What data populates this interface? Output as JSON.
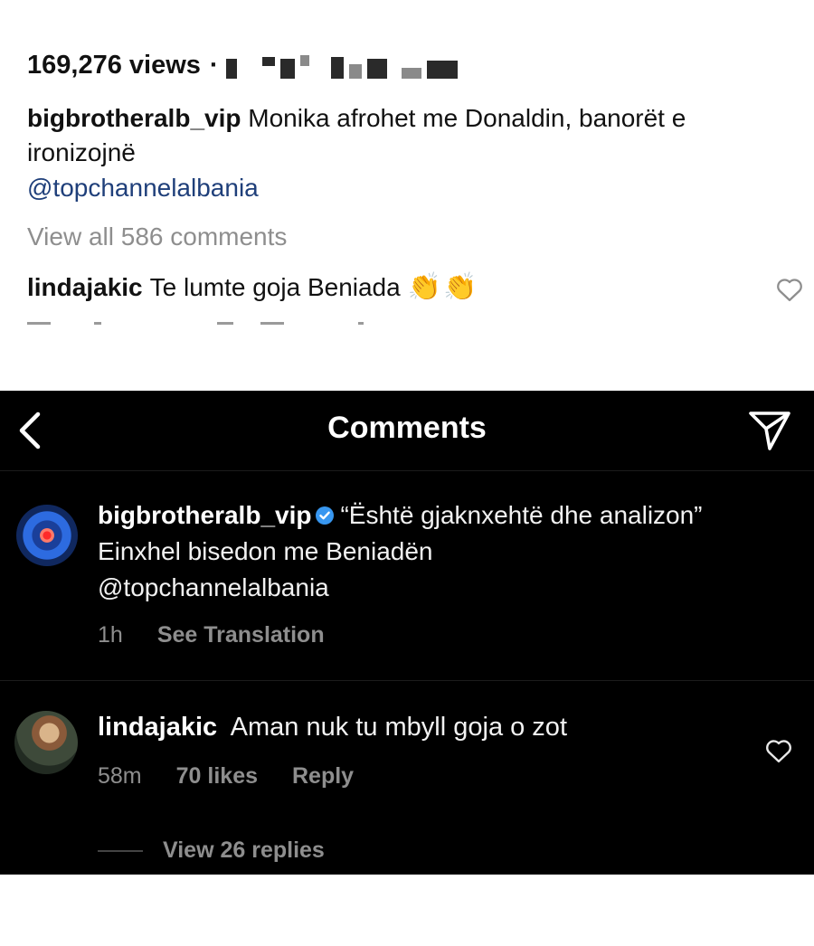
{
  "post_light": {
    "views": "169,276 views",
    "separator": "·",
    "caption_user": "bigbrotheralb_vip",
    "caption_text": "Monika afrohet me Donaldin, banorët e ironizojnë",
    "mention": "@topchannelalbania",
    "view_all": "View all 586 comments",
    "comment": {
      "user": "lindajakic",
      "text": "Te lumte goja Beniada",
      "emoji": "👏👏"
    }
  },
  "comments_screen": {
    "title": "Comments",
    "post": {
      "user": "bigbrotheralb_vip",
      "text_line1": "“Është gjaknxehtë dhe analizon”",
      "text_line2": "Einxhel bisedon me Beniadën",
      "mention": "@topchannelalbania",
      "time": "1h",
      "see_translation": "See Translation"
    },
    "comment": {
      "user": "lindajakic",
      "text": "Aman nuk tu mbyll goja o zot",
      "time": "58m",
      "likes": "70 likes",
      "reply": "Reply",
      "view_replies": "View 26 replies"
    }
  },
  "icons": {
    "back": "chevron-left-icon",
    "send": "paper-plane-icon",
    "like": "heart-icon",
    "verified": "verified-badge-icon"
  },
  "colors": {
    "link_light": "#1f3f7a",
    "muted": "#8e8e8e",
    "verified": "#3897f0",
    "dark_bg": "#000000"
  }
}
